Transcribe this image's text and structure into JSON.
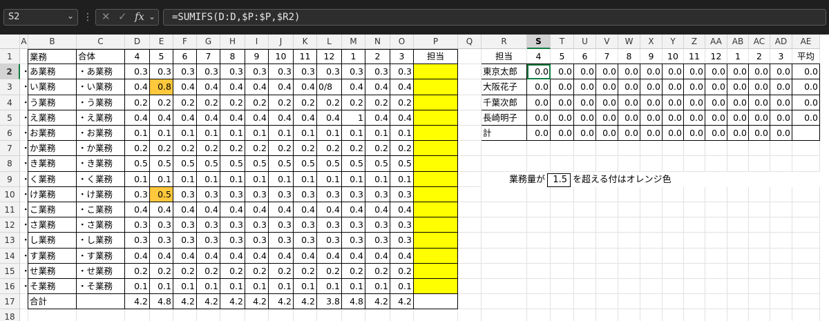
{
  "toolbar": {
    "name_box": "S2",
    "formula": "=SUMIFS(D:D,$P:$P,$R2)"
  },
  "icons": {
    "name_box_dropdown": "chevron-down",
    "more": "vertical-ellipsis",
    "cancel": "x-mark",
    "enter": "check-mark",
    "function": "fx",
    "formula_dropdown": "chevron-down"
  },
  "colors": {
    "accent": "#107c41",
    "highlight": "#ffc83d",
    "assignee_fill": "#ffff00"
  },
  "columns": [
    "A",
    "B",
    "C",
    "D",
    "E",
    "F",
    "G",
    "H",
    "I",
    "J",
    "K",
    "L",
    "M",
    "N",
    "O",
    "P",
    "Q",
    "R",
    "S",
    "T",
    "U",
    "V",
    "W",
    "X",
    "Y",
    "Z",
    "AA",
    "AB",
    "AC",
    "AD",
    "AE"
  ],
  "rows": [
    "1",
    "2",
    "3",
    "4",
    "5",
    "6",
    "7",
    "8",
    "9",
    "10",
    "11",
    "12",
    "13",
    "14",
    "15",
    "16",
    "17",
    "18"
  ],
  "selected_cell": "S2",
  "left_table": {
    "headers": [
      "業務",
      "合体",
      "4",
      "5",
      "6",
      "7",
      "8",
      "9",
      "10",
      "11",
      "12",
      "1",
      "2",
      "3",
      "担当"
    ],
    "rows": [
      {
        "a": "・",
        "b": "あ業務",
        "c": "・あ業務",
        "vals": [
          "0.3",
          "0.3",
          "0.3",
          "0.3",
          "0.3",
          "0.3",
          "0.3",
          "0.3",
          "0.3",
          "0.3",
          "0.3",
          "0.3"
        ]
      },
      {
        "a": "・",
        "b": "い業務",
        "c": "・い業務",
        "vals": [
          "0.4",
          "0.8",
          "0.4",
          "0.4",
          "0.4",
          "0.4",
          "0.4",
          "0.4",
          "0/8",
          "0.4",
          "0.4",
          "0.4"
        ]
      },
      {
        "a": "・",
        "b": "う業務",
        "c": "・う業務",
        "vals": [
          "0.2",
          "0.2",
          "0.2",
          "0.2",
          "0.2",
          "0.2",
          "0.2",
          "0.2",
          "0.2",
          "0.2",
          "0.2",
          "0.2"
        ]
      },
      {
        "a": "・",
        "b": "え業務",
        "c": "・え業務",
        "vals": [
          "0.4",
          "0.4",
          "0.4",
          "0.4",
          "0.4",
          "0.4",
          "0.4",
          "0.4",
          "0.4",
          "1",
          "0.4",
          "0.4"
        ]
      },
      {
        "a": "・",
        "b": "お業務",
        "c": "・お業務",
        "vals": [
          "0.1",
          "0.1",
          "0.1",
          "0.1",
          "0.1",
          "0.1",
          "0.1",
          "0.1",
          "0.1",
          "0.1",
          "0.1",
          "0.1"
        ]
      },
      {
        "a": "・",
        "b": "か業務",
        "c": "・か業務",
        "vals": [
          "0.2",
          "0.2",
          "0.2",
          "0.2",
          "0.2",
          "0.2",
          "0.2",
          "0.2",
          "0.2",
          "0.2",
          "0.2",
          "0.2"
        ]
      },
      {
        "a": "・",
        "b": "き業務",
        "c": "・き業務",
        "vals": [
          "0.5",
          "0.5",
          "0.5",
          "0.5",
          "0.5",
          "0.5",
          "0.5",
          "0.5",
          "0.5",
          "0.5",
          "0.5",
          "0.5"
        ]
      },
      {
        "a": "・",
        "b": "く業務",
        "c": "・く業務",
        "vals": [
          "0.1",
          "0.1",
          "0.1",
          "0.1",
          "0.1",
          "0.1",
          "0.1",
          "0.1",
          "0.1",
          "0.1",
          "0.1",
          "0.1"
        ]
      },
      {
        "a": "・",
        "b": "け業務",
        "c": "・け業務",
        "vals": [
          "0.3",
          "0.5",
          "0.3",
          "0.3",
          "0.3",
          "0.3",
          "0.3",
          "0.3",
          "0.3",
          "0.3",
          "0.3",
          "0.3"
        ]
      },
      {
        "a": "・",
        "b": "こ業務",
        "c": "・こ業務",
        "vals": [
          "0.4",
          "0.4",
          "0.4",
          "0.4",
          "0.4",
          "0.4",
          "0.4",
          "0.4",
          "0.4",
          "0.4",
          "0.4",
          "0.4"
        ]
      },
      {
        "a": "・",
        "b": "さ業務",
        "c": "・さ業務",
        "vals": [
          "0.3",
          "0.3",
          "0.3",
          "0.3",
          "0.3",
          "0.3",
          "0.3",
          "0.3",
          "0.3",
          "0.3",
          "0.3",
          "0.3"
        ]
      },
      {
        "a": "・",
        "b": "し業務",
        "c": "・し業務",
        "vals": [
          "0.3",
          "0.3",
          "0.3",
          "0.3",
          "0.3",
          "0.3",
          "0.3",
          "0.3",
          "0.3",
          "0.3",
          "0.3",
          "0.3"
        ]
      },
      {
        "a": "・",
        "b": "す業務",
        "c": "・す業務",
        "vals": [
          "0.4",
          "0.4",
          "0.4",
          "0.4",
          "0.4",
          "0.4",
          "0.4",
          "0.4",
          "0.4",
          "0.4",
          "0.4",
          "0.4"
        ]
      },
      {
        "a": "・",
        "b": "せ業務",
        "c": "・せ業務",
        "vals": [
          "0.2",
          "0.2",
          "0.2",
          "0.2",
          "0.2",
          "0.2",
          "0.2",
          "0.2",
          "0.2",
          "0.2",
          "0.2",
          "0.2"
        ]
      },
      {
        "a": "・",
        "b": "そ業務",
        "c": "・そ業務",
        "vals": [
          "0.1",
          "0.1",
          "0.1",
          "0.1",
          "0.1",
          "0.1",
          "0.1",
          "0.1",
          "0.1",
          "0.1",
          "0.1",
          "0.1"
        ]
      }
    ],
    "highlighted": [
      [
        1,
        1
      ],
      [
        8,
        1
      ]
    ],
    "total_label": "合計",
    "totals": [
      "4.2",
      "4.8",
      "4.2",
      "4.2",
      "4.2",
      "4.2",
      "4.2",
      "4.2",
      "3.8",
      "4.8",
      "4.2",
      "4.2"
    ]
  },
  "right_table": {
    "headers": [
      "担当",
      "4",
      "5",
      "6",
      "7",
      "8",
      "9",
      "10",
      "11",
      "12",
      "1",
      "2",
      "3",
      "平均"
    ],
    "rows": [
      {
        "name": "東京太郎",
        "vals": [
          "0.0",
          "0.0",
          "0.0",
          "0.0",
          "0.0",
          "0.0",
          "0.0",
          "0.0",
          "0.0",
          "0.0",
          "0.0",
          "0.0",
          "0.0"
        ]
      },
      {
        "name": "大阪花子",
        "vals": [
          "0.0",
          "0.0",
          "0.0",
          "0.0",
          "0.0",
          "0.0",
          "0.0",
          "0.0",
          "0.0",
          "0.0",
          "0.0",
          "0.0",
          "0.0"
        ]
      },
      {
        "name": "千葉次郎",
        "vals": [
          "0.0",
          "0.0",
          "0.0",
          "0.0",
          "0.0",
          "0.0",
          "0.0",
          "0.0",
          "0.0",
          "0.0",
          "0.0",
          "0.0",
          "0.0"
        ]
      },
      {
        "name": "長崎明子",
        "vals": [
          "0.0",
          "0.0",
          "0.0",
          "0.0",
          "0.0",
          "0.0",
          "0.0",
          "0.0",
          "0.0",
          "0.0",
          "0.0",
          "0.0",
          "0.0"
        ]
      },
      {
        "name": "計",
        "vals": [
          "0.0",
          "0.0",
          "0.0",
          "0.0",
          "0.0",
          "0.0",
          "0.0",
          "0.0",
          "0.0",
          "0.0",
          "0.0",
          "0.0",
          ""
        ]
      }
    ]
  },
  "threshold": {
    "prefix": "業務量が",
    "value": "1.5",
    "suffix": "を超える付はオレンジ色"
  }
}
